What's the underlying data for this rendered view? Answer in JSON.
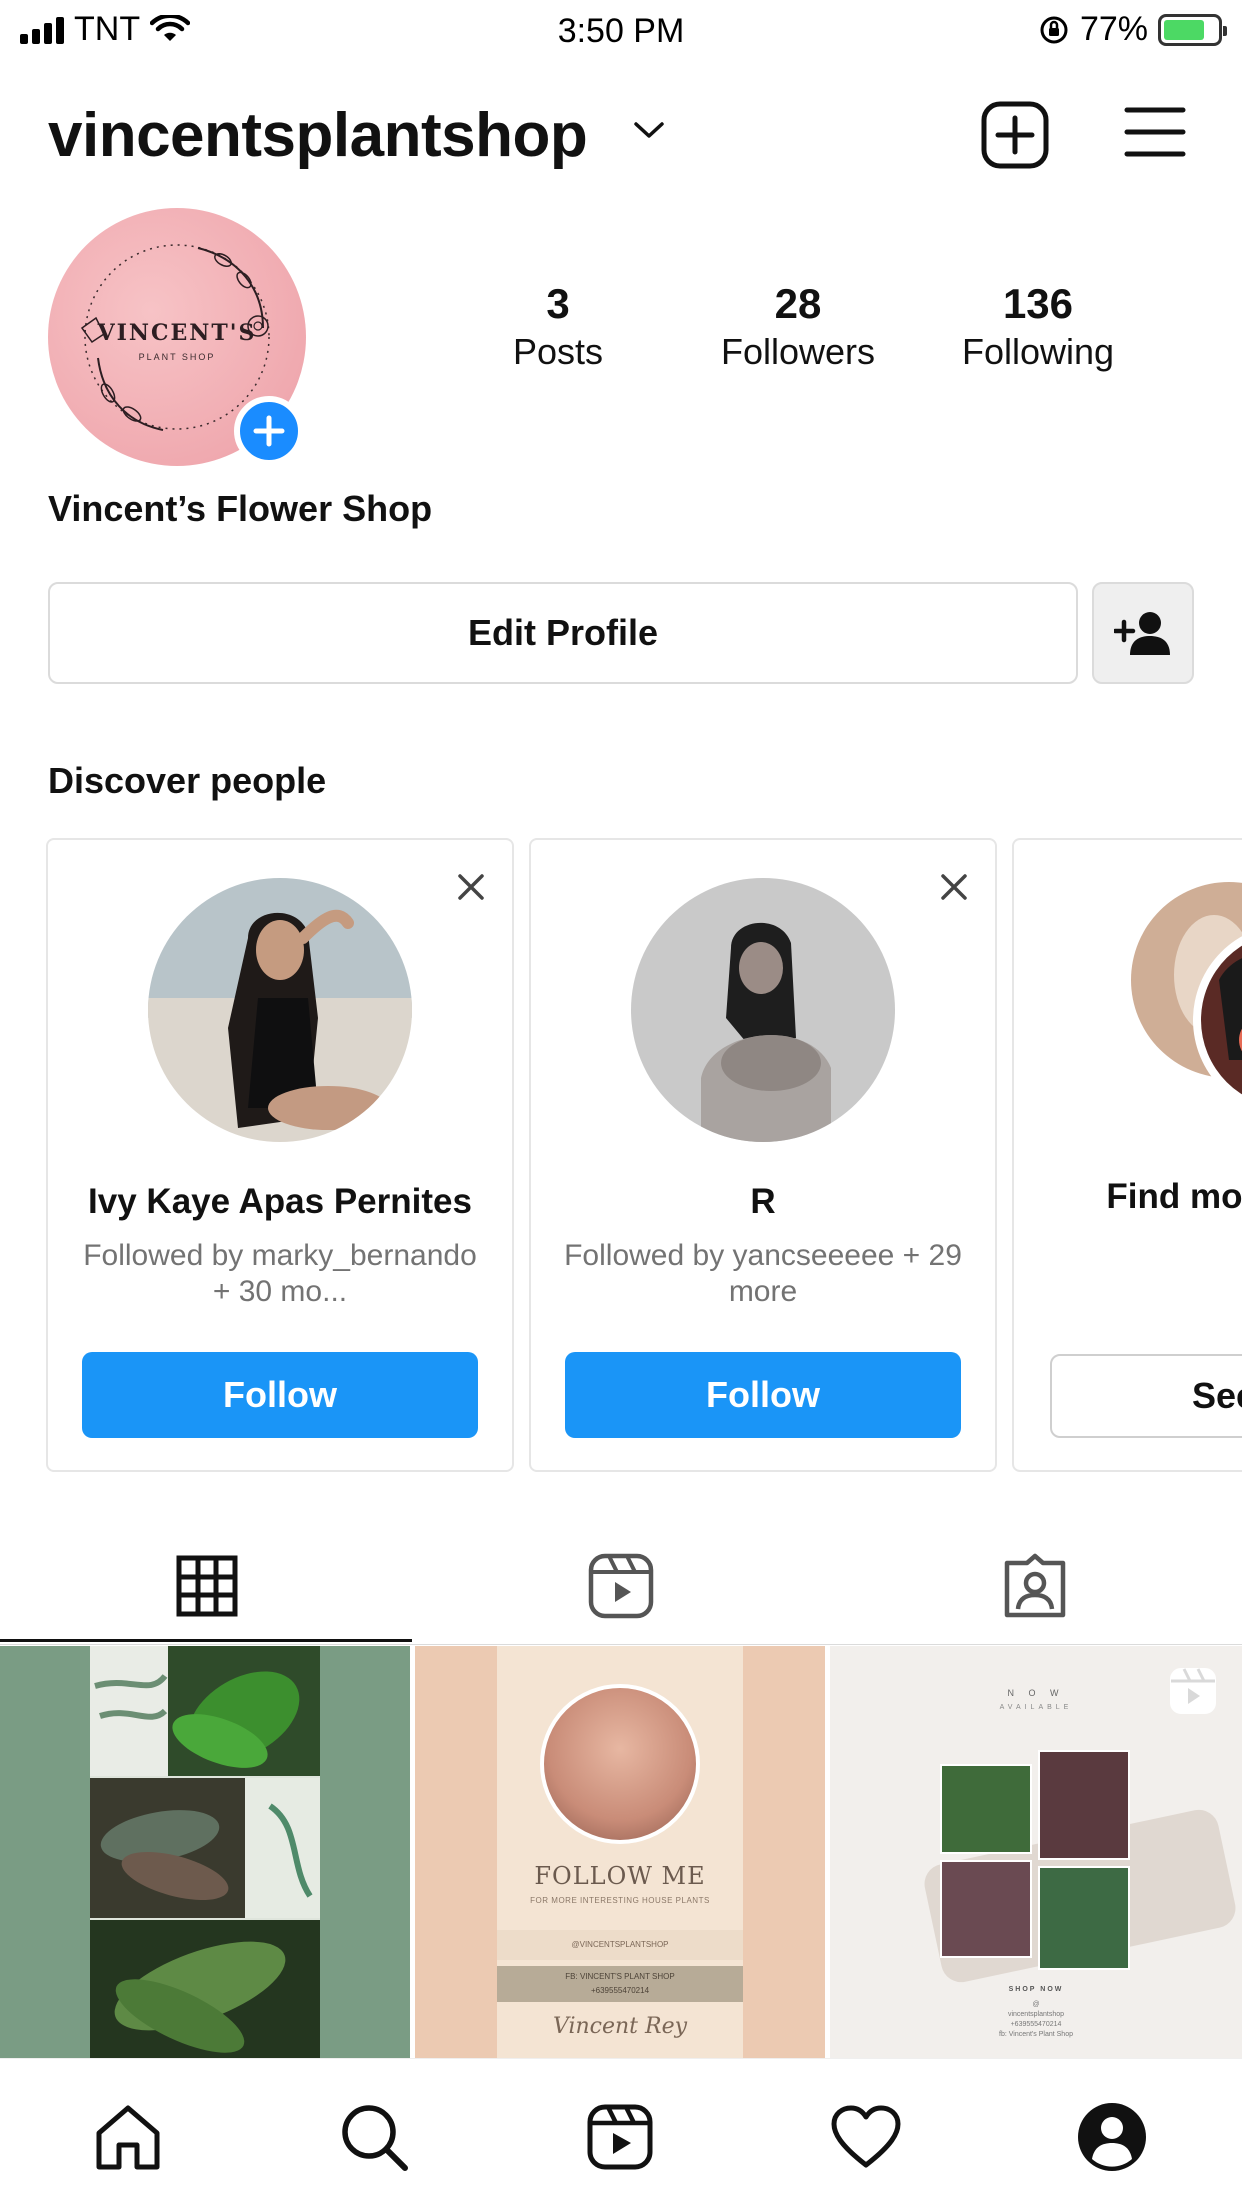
{
  "status_bar": {
    "carrier": "TNT",
    "time": "3:50 PM",
    "battery_percent": "77%",
    "battery_level": 0.77,
    "icons": [
      "cellular-signal-icon",
      "wifi-icon",
      "orientation-lock-icon",
      "battery-charging-icon"
    ]
  },
  "header": {
    "username": "vincentsplantshop",
    "icons": [
      "chevron-down-icon",
      "new-post-icon",
      "menu-icon"
    ]
  },
  "profile": {
    "avatar_text": "VINCENT'S",
    "avatar_subtext": "PLANT SHOP",
    "display_name": "Vincent’s Flower Shop",
    "stats": [
      {
        "value": "3",
        "label": "Posts"
      },
      {
        "value": "28",
        "label": "Followers"
      },
      {
        "value": "136",
        "label": "Following"
      }
    ],
    "edit_profile_label": "Edit Profile"
  },
  "discover": {
    "title": "Discover people",
    "cards": [
      {
        "name": "Ivy Kaye Apas Pernites",
        "subtitle": "Followed by marky_bernando + 30 mo...",
        "button": "Follow"
      },
      {
        "name": "R",
        "subtitle": "Followed by yancseeeee + 29 more",
        "button": "Follow"
      }
    ],
    "more_card": {
      "text": "Find mor to fo",
      "button": "See"
    }
  },
  "tabs": {
    "items": [
      "grid-icon",
      "reels-icon",
      "tagged-icon"
    ],
    "active": 0
  },
  "posts": {
    "post2": {
      "title": "FOLLOW ME",
      "subtitle": "FOR MORE INTERESTING HOUSE PLANTS",
      "handle": "@VINCENTSPLANTSHOP",
      "fb": "FB: VINCENT'S PLANT SHOP",
      "phone": "+639555470214",
      "signature": "Vincent Rey"
    },
    "post3": {
      "now": "N O W",
      "available": "AVAILABLE",
      "shop_now": "SHOP NOW",
      "info_line1": "@",
      "info_line2": "vincentsplantshop",
      "info_line3": "+639555470214",
      "info_line4": "fb: Vincent's Plant Shop"
    }
  },
  "bottom_nav": [
    "home-icon",
    "search-icon",
    "reels-icon",
    "heart-icon",
    "profile-icon"
  ],
  "colors": {
    "accent_blue": "#1a95f7",
    "text": "#111111",
    "muted": "#737373",
    "border": "#dbdbdb"
  }
}
